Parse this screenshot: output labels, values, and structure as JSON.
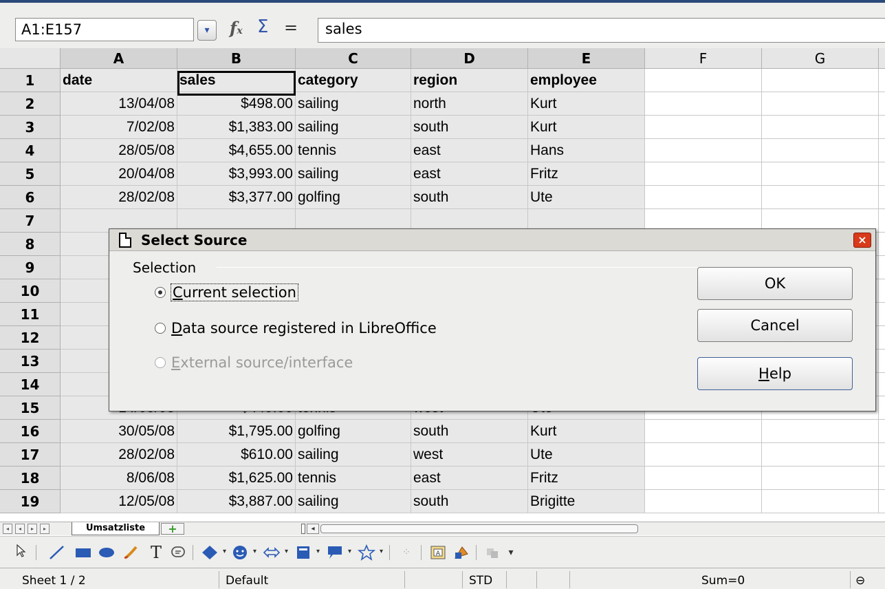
{
  "formula_bar": {
    "name_box": "A1:E157",
    "function_wizard_icon": "function-wizard-icon",
    "sum_icon": "sum-icon",
    "sum_glyph": "Σ",
    "equals_glyph": "=",
    "input_value": "sales"
  },
  "columns": [
    "A",
    "B",
    "C",
    "D",
    "E",
    "F",
    "G"
  ],
  "rows": [
    {
      "n": "1",
      "a": "date",
      "b": "sales",
      "c": "category",
      "d": "region",
      "e": "employee"
    },
    {
      "n": "2",
      "a": "13/04/08",
      "b": "$498.00",
      "c": "sailing",
      "d": "north",
      "e": "Kurt"
    },
    {
      "n": "3",
      "a": "7/02/08",
      "b": "$1,383.00",
      "c": "sailing",
      "d": "south",
      "e": "Kurt"
    },
    {
      "n": "4",
      "a": "28/05/08",
      "b": "$4,655.00",
      "c": "tennis",
      "d": "east",
      "e": "Hans"
    },
    {
      "n": "5",
      "a": "20/04/08",
      "b": "$3,993.00",
      "c": "sailing",
      "d": "east",
      "e": "Fritz"
    },
    {
      "n": "6",
      "a": "28/02/08",
      "b": "$3,377.00",
      "c": "golfing",
      "d": "south",
      "e": "Ute"
    },
    {
      "n": "7",
      "a": "",
      "b": "",
      "c": "",
      "d": "",
      "e": ""
    },
    {
      "n": "8",
      "a": "",
      "b": "",
      "c": "",
      "d": "",
      "e": ""
    },
    {
      "n": "9",
      "a": "",
      "b": "",
      "c": "",
      "d": "",
      "e": ""
    },
    {
      "n": "10",
      "a": "",
      "b": "",
      "c": "",
      "d": "",
      "e": ""
    },
    {
      "n": "11",
      "a": "",
      "b": "",
      "c": "",
      "d": "",
      "e": ""
    },
    {
      "n": "12",
      "a": "",
      "b": "",
      "c": "",
      "d": "",
      "e": ""
    },
    {
      "n": "13",
      "a": "",
      "b": "",
      "c": "",
      "d": "",
      "e": ""
    },
    {
      "n": "14",
      "a": "",
      "b": "",
      "c": "",
      "d": "",
      "e": ""
    },
    {
      "n": "15",
      "a": "14/05/08",
      "b": "$449.00",
      "c": "tennis",
      "d": "west",
      "e": "Ute"
    },
    {
      "n": "16",
      "a": "30/05/08",
      "b": "$1,795.00",
      "c": "golfing",
      "d": "south",
      "e": "Kurt"
    },
    {
      "n": "17",
      "a": "28/02/08",
      "b": "$610.00",
      "c": "sailing",
      "d": "west",
      "e": "Ute"
    },
    {
      "n": "18",
      "a": "8/06/08",
      "b": "$1,625.00",
      "c": "tennis",
      "d": "east",
      "e": "Fritz"
    },
    {
      "n": "19",
      "a": "12/05/08",
      "b": "$3,887.00",
      "c": "sailing",
      "d": "south",
      "e": "Brigitte"
    }
  ],
  "dialog": {
    "title": "Select Source",
    "close_glyph": "×",
    "group_label": "Selection",
    "options": [
      {
        "label": "Current selection",
        "selected": true,
        "enabled": true
      },
      {
        "label": "Data source registered in LibreOffice",
        "selected": false,
        "enabled": true
      },
      {
        "label": "External source/interface",
        "selected": false,
        "enabled": false
      }
    ],
    "ok_label": "OK",
    "cancel_label": "Cancel",
    "help_label": "Help"
  },
  "sheet_tabs": {
    "active_tab": "Umsatzliste",
    "add_glyph": "+"
  },
  "status_bar": {
    "sheet": "Sheet 1 / 2",
    "page_style": "Default",
    "mode": "STD",
    "sum": "Sum=0"
  }
}
